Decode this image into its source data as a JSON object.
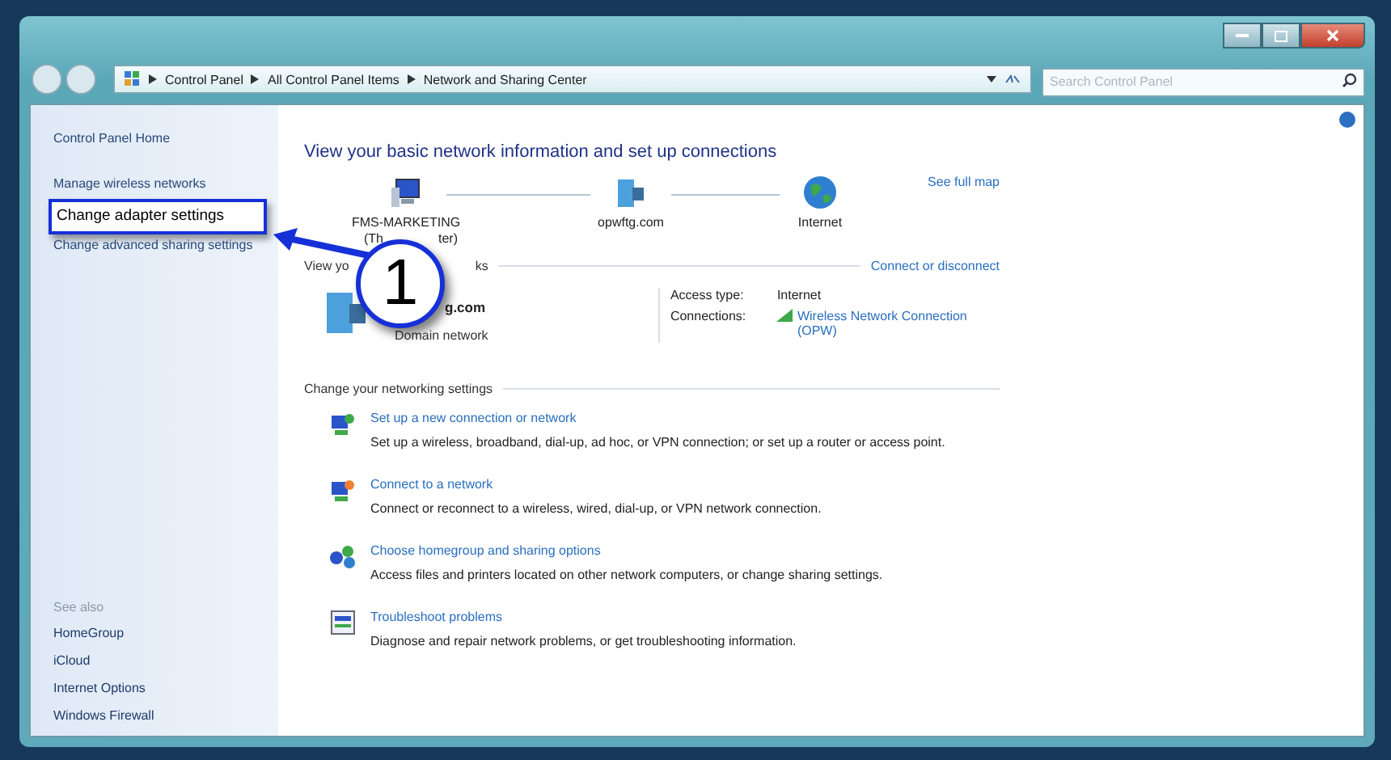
{
  "window": {
    "breadcrumb": [
      "Control Panel",
      "All Control Panel Items",
      "Network and Sharing Center"
    ],
    "search": {
      "placeholder": "Search Control Panel"
    }
  },
  "sidebar": {
    "items": [
      {
        "label": "Control Panel Home",
        "selected": false
      },
      {
        "label": "Manage wireless networks",
        "selected": false
      },
      {
        "label": "Change adapter settings",
        "selected": true
      },
      {
        "label": "Change advanced sharing settings",
        "selected": false
      }
    ],
    "see_also_heading": "See also",
    "see_also": [
      "HomeGroup",
      "iCloud",
      "Internet Options",
      "Windows Firewall"
    ]
  },
  "heading": "View your basic network information and set up connections",
  "map": {
    "nodes": [
      {
        "kind": "computer",
        "label": "FMS-MARKETING",
        "sub_parts": [
          "(Th",
          "ter)"
        ]
      },
      {
        "kind": "domain",
        "label": "opwftg.com"
      },
      {
        "kind": "internet",
        "label": "Internet"
      }
    ],
    "link": "See full map"
  },
  "active_networks": {
    "heading_parts": [
      "View yo",
      "ks"
    ],
    "link": "Connect or disconnect",
    "name": "g.com",
    "type": "Domain network",
    "access_label": "Access type:",
    "access_value": "Internet",
    "connections_label": "Connections:",
    "connection": "Wireless Network Connection (OPW)"
  },
  "settings_heading": "Change your networking settings",
  "tasks": [
    {
      "kind": "new",
      "title": "Set up a new connection or network",
      "desc": "Set up a wireless, broadband, dial-up, ad hoc, or VPN connection; or set up a router or access point."
    },
    {
      "kind": "connect",
      "title": "Connect to a network",
      "desc": "Connect or reconnect to a wireless, wired, dial-up, or VPN network connection."
    },
    {
      "kind": "homegroup",
      "title": "Choose homegroup and sharing options",
      "desc": "Access files and printers located on other network computers, or change sharing settings."
    },
    {
      "kind": "troubleshoot",
      "title": "Troubleshoot problems",
      "desc": "Diagnose and repair network problems, or get troubleshooting information."
    }
  ],
  "callout": {
    "number": "1"
  }
}
